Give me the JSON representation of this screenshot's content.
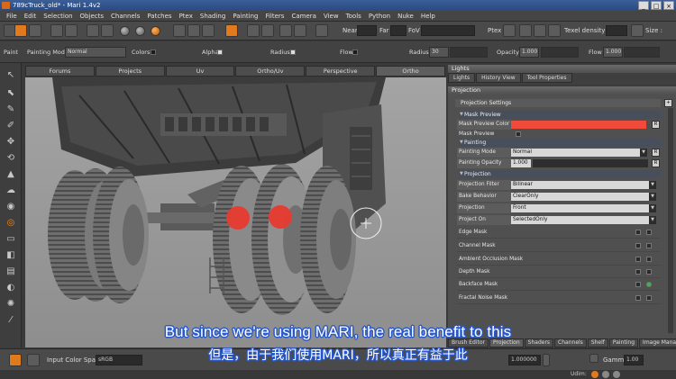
{
  "window": {
    "title": "789cTruck_old* - Mari 1.4v2",
    "controls": [
      "_",
      "□",
      "×"
    ]
  },
  "menu": [
    "File",
    "Edit",
    "Selection",
    "Objects",
    "Channels",
    "Patches",
    "Ptex",
    "Shading",
    "Painting",
    "Filters",
    "Camera",
    "View",
    "Tools",
    "Python",
    "Nuke",
    "Help"
  ],
  "toolbar": {
    "near_label": "Near",
    "far_label": "Far",
    "fov_label": "FoV",
    "ptex_label": "Ptex",
    "texel_label": "Texel density :",
    "size_label": "Size :"
  },
  "paintbar": {
    "paint_label": "Paint",
    "painting_mode_label": "Painting Mode",
    "painting_mode_value": "Normal",
    "colors_label": "Colors",
    "alpha_label": "Alpha",
    "radius_label": "Radius",
    "flow_label": "Flow",
    "radius2_label": "Radius",
    "radius2_value": "30",
    "opacity_label": "Opacity",
    "opacity_value": "1.000",
    "flow2_label": "Flow",
    "flow2_value": "1.000"
  },
  "viewport_tabs": [
    "Forums",
    "Projects",
    "Uv",
    "Ortho/Uv",
    "Perspective",
    "Ortho"
  ],
  "lights_panel": {
    "title": "Lights",
    "tabs": [
      "Lights",
      "History View",
      "Tool Properties"
    ]
  },
  "projection_panel": {
    "title": "Projection",
    "settings_label": "Projection Settings",
    "mask_preview_section": "Mask Preview",
    "mask_preview_color_label": "Mask Preview Color",
    "mask_preview_color": "#f04a3a",
    "mask_preview_enabled_label": "Mask Preview Enabled",
    "painting_section": "Painting",
    "painting_mode_label": "Painting Mode",
    "painting_mode_value": "Normal",
    "painting_opacity_label": "Painting Opacity",
    "painting_opacity_value": "1.000",
    "projection_section": "Projection",
    "projection_filter_label": "Projection Filter",
    "projection_filter_value": "Bilinear",
    "bake_behavior_label": "Bake Behavior",
    "bake_behavior_value": "ClearOnly",
    "projection_label": "Projection",
    "projection_value": "Front",
    "project_on_label": "Project On",
    "project_on_value": "SelectedOnly",
    "masks": [
      "Edge Mask",
      "Channel Mask",
      "Ambient Occlusion Mask",
      "Depth Mask",
      "Backface Mask",
      "Fractal Noise Mask"
    ]
  },
  "bottom_right_tabs": [
    "Brush Editor",
    "Projection",
    "Shaders",
    "Channels",
    "Shelf",
    "Painting",
    "Image Manager"
  ],
  "statusbar": {
    "input_color_space_label": "Input Color Space",
    "input_color_space_value": "sRGB",
    "exposure_value": "1.000000",
    "gamma_label": "Gamma",
    "gamma_value": "1.00",
    "udim_label": "Udim:"
  },
  "subtitles": {
    "english": "But since we're using MARI, the real benefit to this",
    "chinese": "但是，由于我们使用MARI，所以真正有益于此"
  }
}
